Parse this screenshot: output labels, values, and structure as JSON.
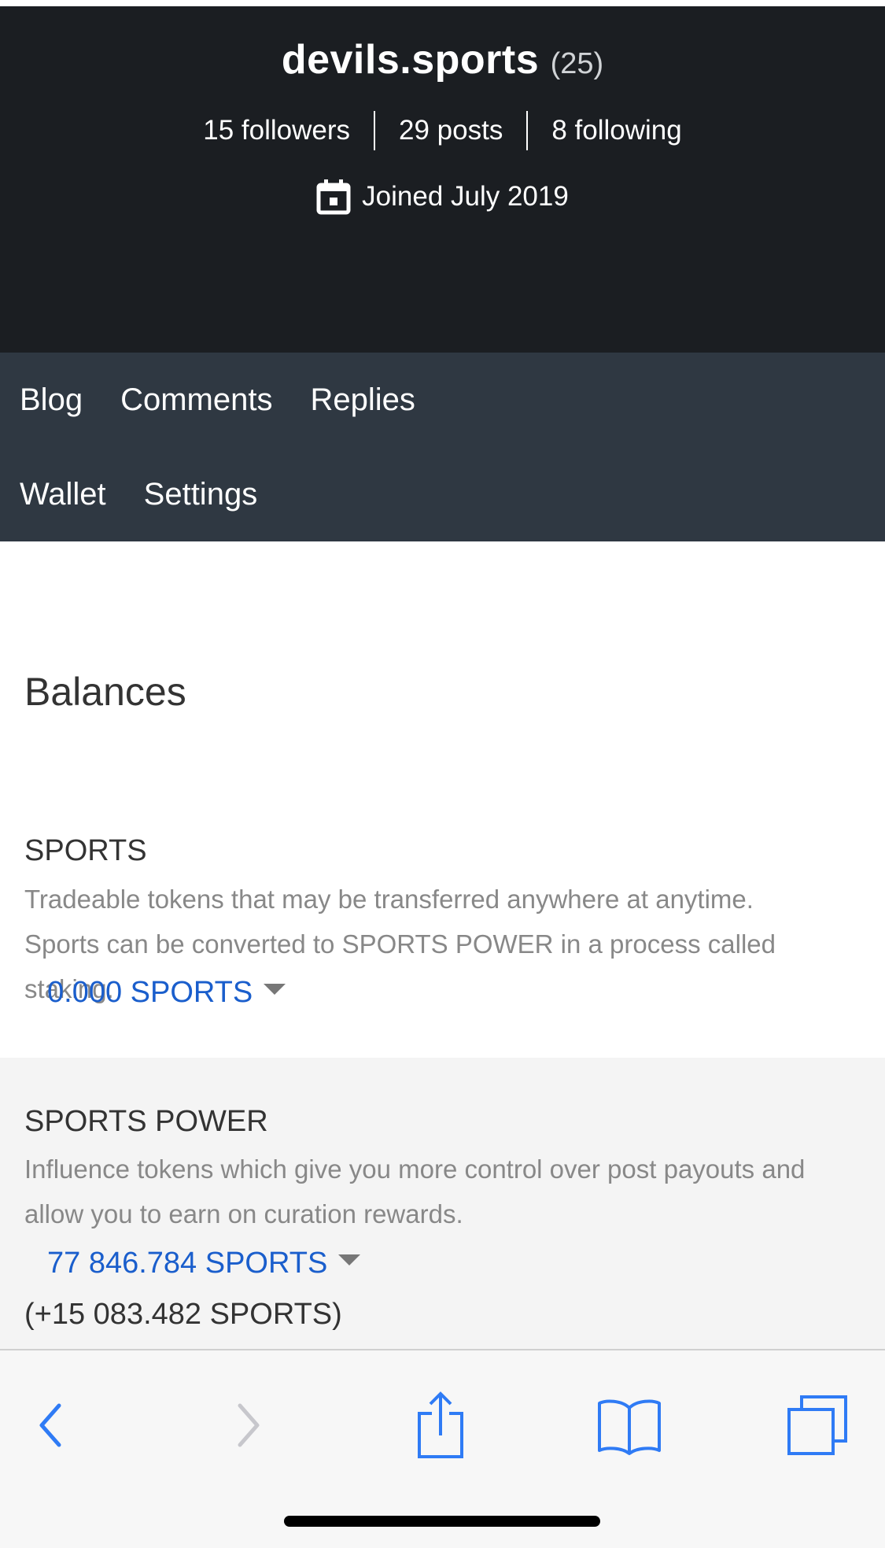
{
  "profile": {
    "name": "devils.sports",
    "reputation": "(25)",
    "followers": "15 followers",
    "posts": "29 posts",
    "following": "8 following",
    "joined": "Joined July 2019"
  },
  "nav": {
    "items": [
      "Blog",
      "Comments",
      "Replies",
      "Wallet",
      "Settings"
    ]
  },
  "balances": {
    "title": "Balances",
    "sports": {
      "title": "SPORTS",
      "desc_line1": "Tradeable tokens that may be transferred anywhere at anytime.",
      "desc_line2": "Sports can be converted to SPORTS POWER in a process called staking.",
      "value": "0.000 SPORTS"
    },
    "sports_power": {
      "title": "SPORTS POWER",
      "desc_line1": "Influence tokens which give you more control over post payouts and",
      "desc_line2": "allow you to earn on curation rewards.",
      "value": "77 846.784 SPORTS",
      "delegated": "(+15 083.482 SPORTS)"
    }
  },
  "toolbar": {
    "icons": [
      "back-icon",
      "forward-icon",
      "share-icon",
      "bookmarks-icon",
      "tabs-icon"
    ]
  },
  "colors": {
    "header_bg": "#1b1e22",
    "nav_bg": "#2f3842",
    "link_blue": "#1a5ecc",
    "ios_blue": "#2f7bf5",
    "muted_text": "#888888"
  }
}
